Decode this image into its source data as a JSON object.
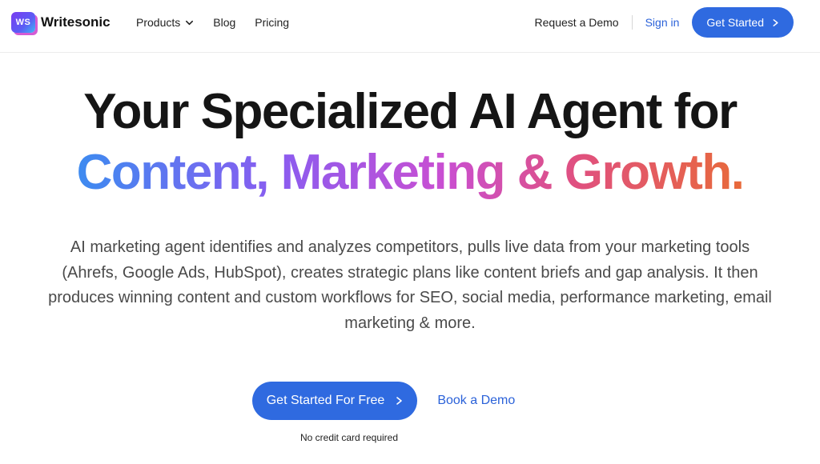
{
  "brand": {
    "logo_mark": "WS",
    "name": "Writesonic"
  },
  "nav": {
    "items": [
      {
        "label": "Products",
        "icon": "chevron-down-icon"
      },
      {
        "label": "Blog"
      },
      {
        "label": "Pricing"
      }
    ],
    "request_demo": "Request a Demo",
    "sign_in": "Sign in",
    "get_started": "Get Started"
  },
  "hero": {
    "title_line1": "Your Specialized AI Agent for",
    "title_line2": "Content, Marketing & Growth.",
    "description": "AI marketing agent identifies and analyzes competitors, pulls live data from your marketing tools (Ahrefs, Google Ads, HubSpot), creates strategic plans like content briefs and gap analysis. It then produces winning content and custom workflows for SEO, social media, performance marketing, email marketing & more.",
    "cta_primary": "Get Started For Free",
    "cta_secondary": "Book a Demo",
    "note": "No credit card required"
  },
  "colors": {
    "accent": "#2f6ae0",
    "link": "#2b62d9",
    "gradient": [
      "#3d8bf0",
      "#8a5cf0",
      "#c94fd2",
      "#e0507f",
      "#e86a3a"
    ]
  }
}
